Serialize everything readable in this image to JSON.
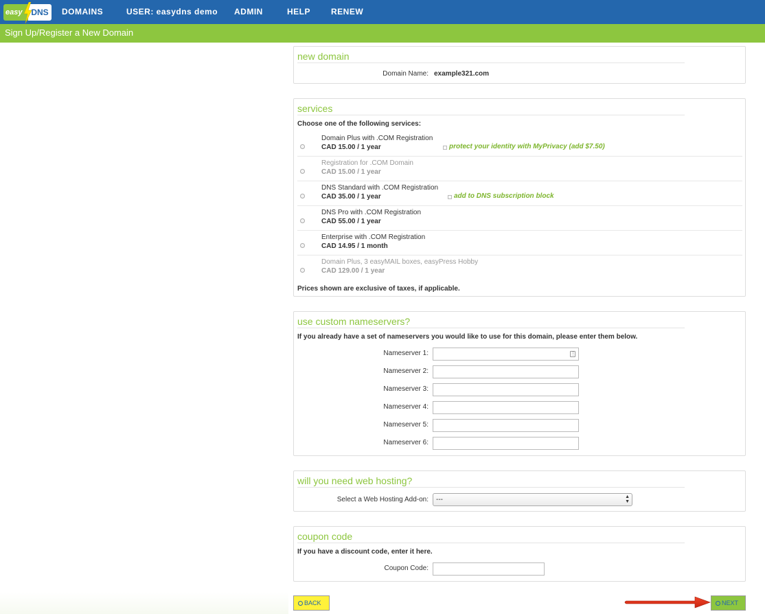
{
  "header": {
    "logo": {
      "easy": "easy",
      "dns": "DNS"
    },
    "nav": [
      {
        "label": "DOMAINS"
      },
      {
        "label": "USER: easydns demo"
      },
      {
        "label": "ADMIN"
      },
      {
        "label": "HELP"
      },
      {
        "label": "RENEW"
      }
    ]
  },
  "subheader": {
    "title": "Sign Up/Register a New Domain"
  },
  "new_domain": {
    "title": "new domain",
    "label": "Domain Name:",
    "value": "example321.com"
  },
  "services": {
    "title": "services",
    "intro": "Choose one of the following services:",
    "items": [
      {
        "name": "Domain Plus with .COM Registration",
        "price": "CAD 15.00 / 1 year",
        "addon": "protect your identity with MyPrivacy (add $7.50)"
      },
      {
        "name": "Registration for .COM Domain",
        "price": "CAD 15.00 / 1 year"
      },
      {
        "name": "DNS Standard with .COM Registration",
        "price": "CAD 35.00 / 1 year",
        "addon": "add to DNS subscription block"
      },
      {
        "name": "DNS Pro with .COM Registration",
        "price": "CAD 55.00 / 1 year"
      },
      {
        "name": "Enterprise with .COM Registration",
        "price": "CAD 14.95 / 1 month"
      },
      {
        "name": "Domain Plus, 3 easyMAIL boxes, easyPress Hobby",
        "price": "CAD 129.00 / 1 year"
      }
    ],
    "footnote": "Prices shown are exclusive of taxes, if applicable."
  },
  "nameservers": {
    "title": "use custom nameservers?",
    "intro": "If you already have a set of nameservers you would like to use for this domain, please enter them below.",
    "fields": [
      {
        "label": "Nameserver 1:",
        "value": ""
      },
      {
        "label": "Nameserver 2:",
        "value": ""
      },
      {
        "label": "Nameserver 3:",
        "value": ""
      },
      {
        "label": "Nameserver 4:",
        "value": ""
      },
      {
        "label": "Nameserver 5:",
        "value": ""
      },
      {
        "label": "Nameserver 6:",
        "value": ""
      }
    ]
  },
  "hosting": {
    "title": "will you need web hosting?",
    "label": "Select a Web Hosting Add-on:",
    "selected": "---"
  },
  "coupon": {
    "title": "coupon code",
    "intro": "If you have a discount code, enter it here.",
    "label": "Coupon Code:",
    "value": ""
  },
  "buttons": {
    "back": "BACK",
    "next": "NEXT"
  },
  "colors": {
    "brand_blue": "#2467ad",
    "brand_green": "#8dc63f",
    "back_yellow": "#fff23a",
    "arrow_red": "#e8341c"
  }
}
